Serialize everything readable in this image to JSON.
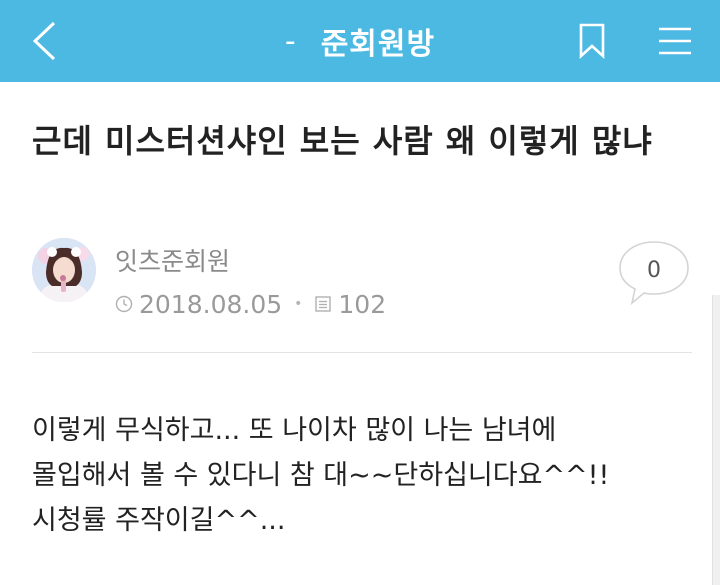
{
  "header": {
    "background": "#4cb9e3",
    "back_icon": "chevron-left-icon",
    "dash": "-",
    "board_name": "준회원방",
    "bookmark_icon": "bookmark-icon",
    "menu_icon": "hamburger-menu-icon"
  },
  "post": {
    "title": "근데 미스터션샤인 보는 사람 왜 이렇게 많냐",
    "author": "잇츠준회원",
    "date": "2018.08.05",
    "views": "102",
    "comment_count": "0",
    "body_lines": [
      "이렇게 무식하고... 또 나이차 많이 나는 남녀에",
      "몰입해서 볼 수 있다니 참 대~~단하십니다요^^!!",
      "시청률 주작이길^^..."
    ]
  }
}
